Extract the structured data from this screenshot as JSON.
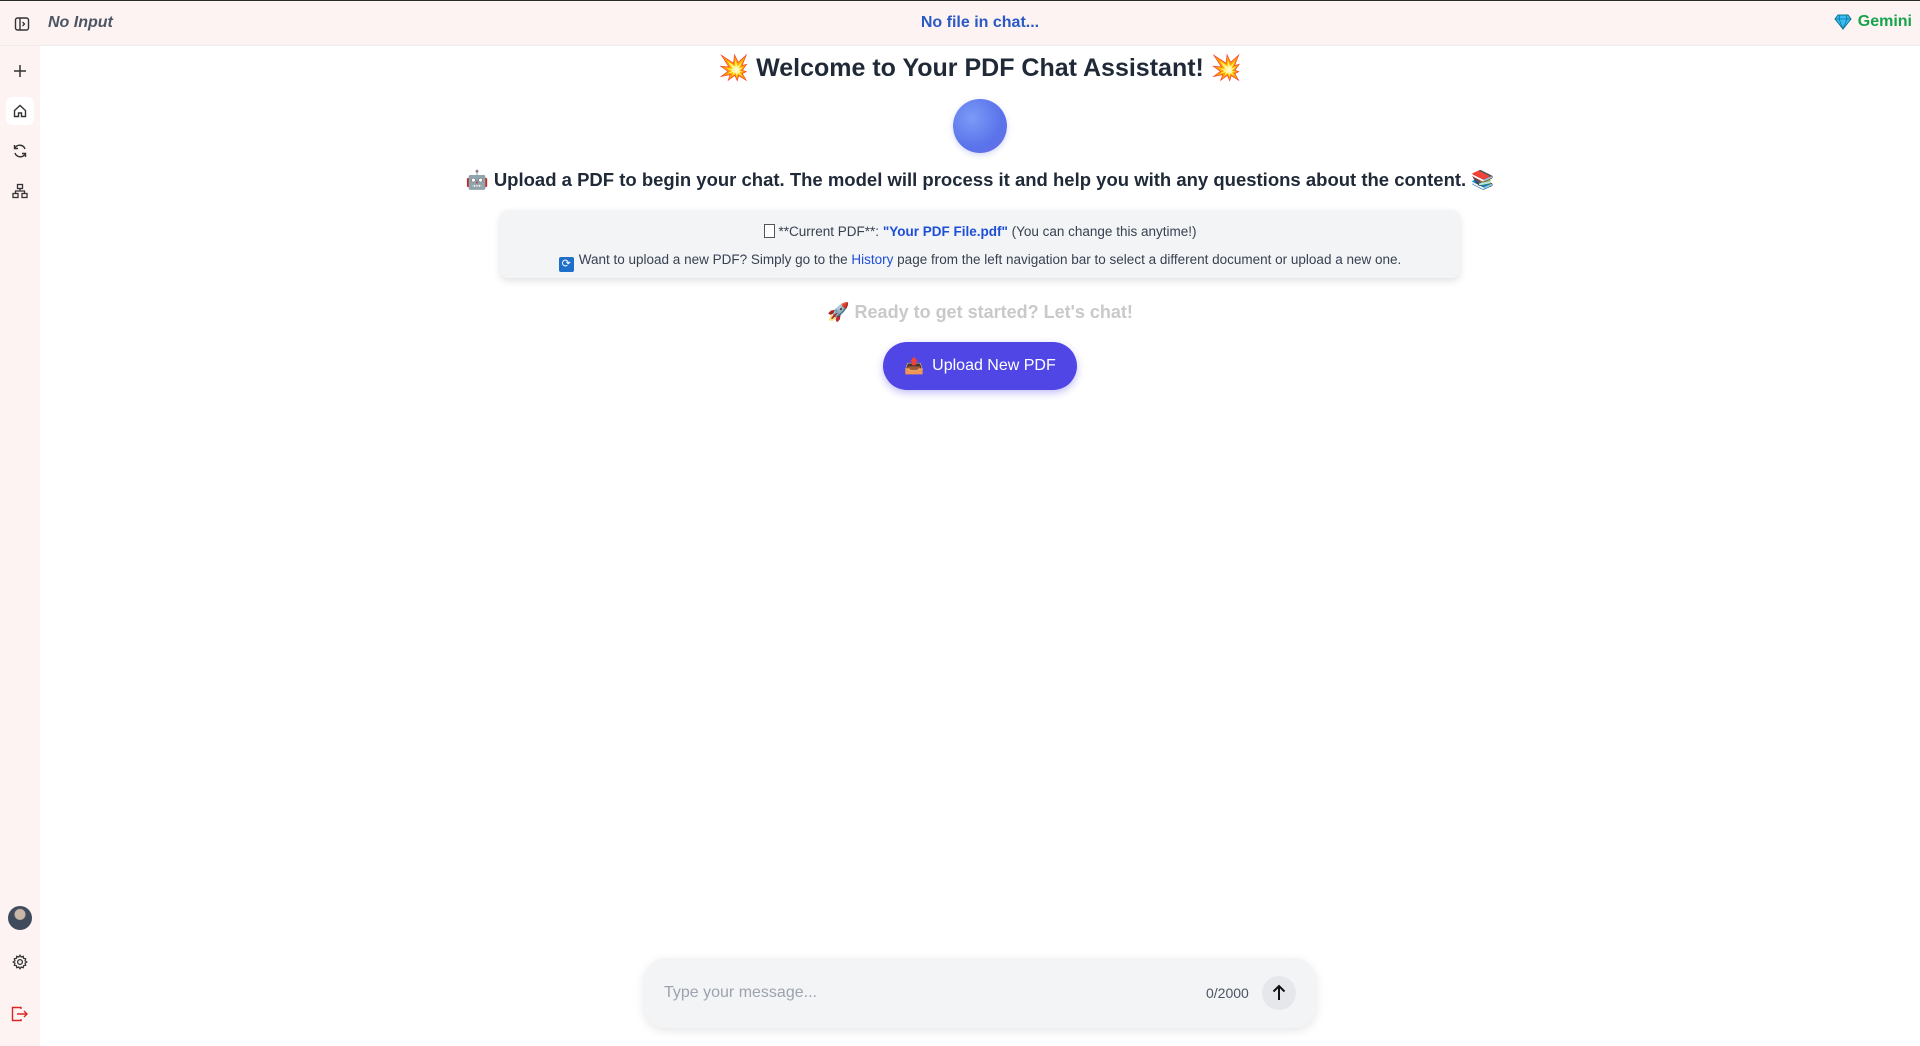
{
  "header": {
    "input_label": "No Input",
    "file_status": "No file in chat...",
    "model_name": "Gemini",
    "model_icon": "diamond-icon"
  },
  "sidebar": {
    "items": [
      {
        "name": "new-chat",
        "icon": "plus-icon"
      },
      {
        "name": "home",
        "icon": "home-icon",
        "active": true
      },
      {
        "name": "history",
        "icon": "refresh-icon"
      },
      {
        "name": "network",
        "icon": "sitemap-icon"
      }
    ],
    "bottom": [
      {
        "name": "avatar"
      },
      {
        "name": "settings",
        "icon": "gear-icon"
      },
      {
        "name": "logout",
        "icon": "logout-icon"
      }
    ]
  },
  "welcome": {
    "title": "Welcome to Your PDF Chat Assistant!",
    "subtitle": "Upload a PDF to begin your chat. The model will process it and help you with any questions about the content.",
    "info_line1_prefix": "**Current PDF**: ",
    "current_pdf": "\"Your PDF File.pdf\"",
    "info_line1_suffix": " (You can change this anytime!)",
    "info_line2_prefix": "Want to upload a new PDF? Simply go to the ",
    "history_link": "History",
    "info_line2_suffix": " page from the left navigation bar to select a different document or upload a new one.",
    "ready_text": "Ready to get started? Let's chat!",
    "upload_button": "Upload New PDF"
  },
  "chat": {
    "placeholder": "Type your message...",
    "char_count": "0/2000"
  },
  "colors": {
    "accent": "#4f46e5",
    "header_bg": "#fdf3f3",
    "link": "#1d4ed8",
    "model": "#16a34a",
    "logout": "#dc2626"
  }
}
